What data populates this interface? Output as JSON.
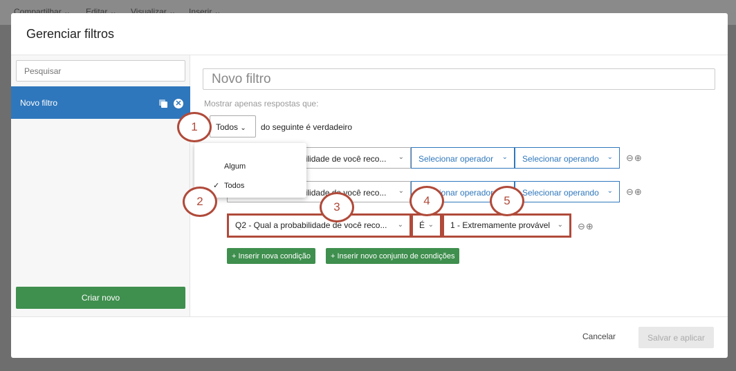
{
  "topbar": {
    "items": [
      "Compartilhar",
      "Editar",
      "Visualizar",
      "Inserir"
    ]
  },
  "modal": {
    "title": "Gerenciar filtros"
  },
  "sidebar": {
    "search_placeholder": "Pesquisar",
    "items": [
      {
        "label": "Novo filtro"
      }
    ],
    "create_label": "Criar novo"
  },
  "editor": {
    "filter_name": "Novo filtro",
    "hint": "Mostrar apenas respostas que:",
    "match_value": "Todos",
    "match_suffix": "do seguinte é verdadeiro",
    "match_options": [
      "Algum",
      "Todos"
    ],
    "conditions": [
      {
        "question": "Q2 - Qual a probabilidade de você reco...",
        "operator": "Selecionar operador",
        "operand": "Selecionar operando"
      },
      {
        "question": "Q2 - Qual a probabilidade de você reco...",
        "operator": "Selecionar operador",
        "operand": "Selecionar operando"
      },
      {
        "question": "Q2 - Qual a probabilidade de você reco...",
        "operator": "É",
        "operand": "1 - Extremamente provável"
      }
    ],
    "add_condition": "Inserir nova condição",
    "add_condition_set": "Inserir novo conjunto de condições"
  },
  "callouts": [
    "1",
    "2",
    "3",
    "4",
    "5"
  ],
  "footer": {
    "cancel": "Cancelar",
    "save": "Salvar e aplicar"
  }
}
